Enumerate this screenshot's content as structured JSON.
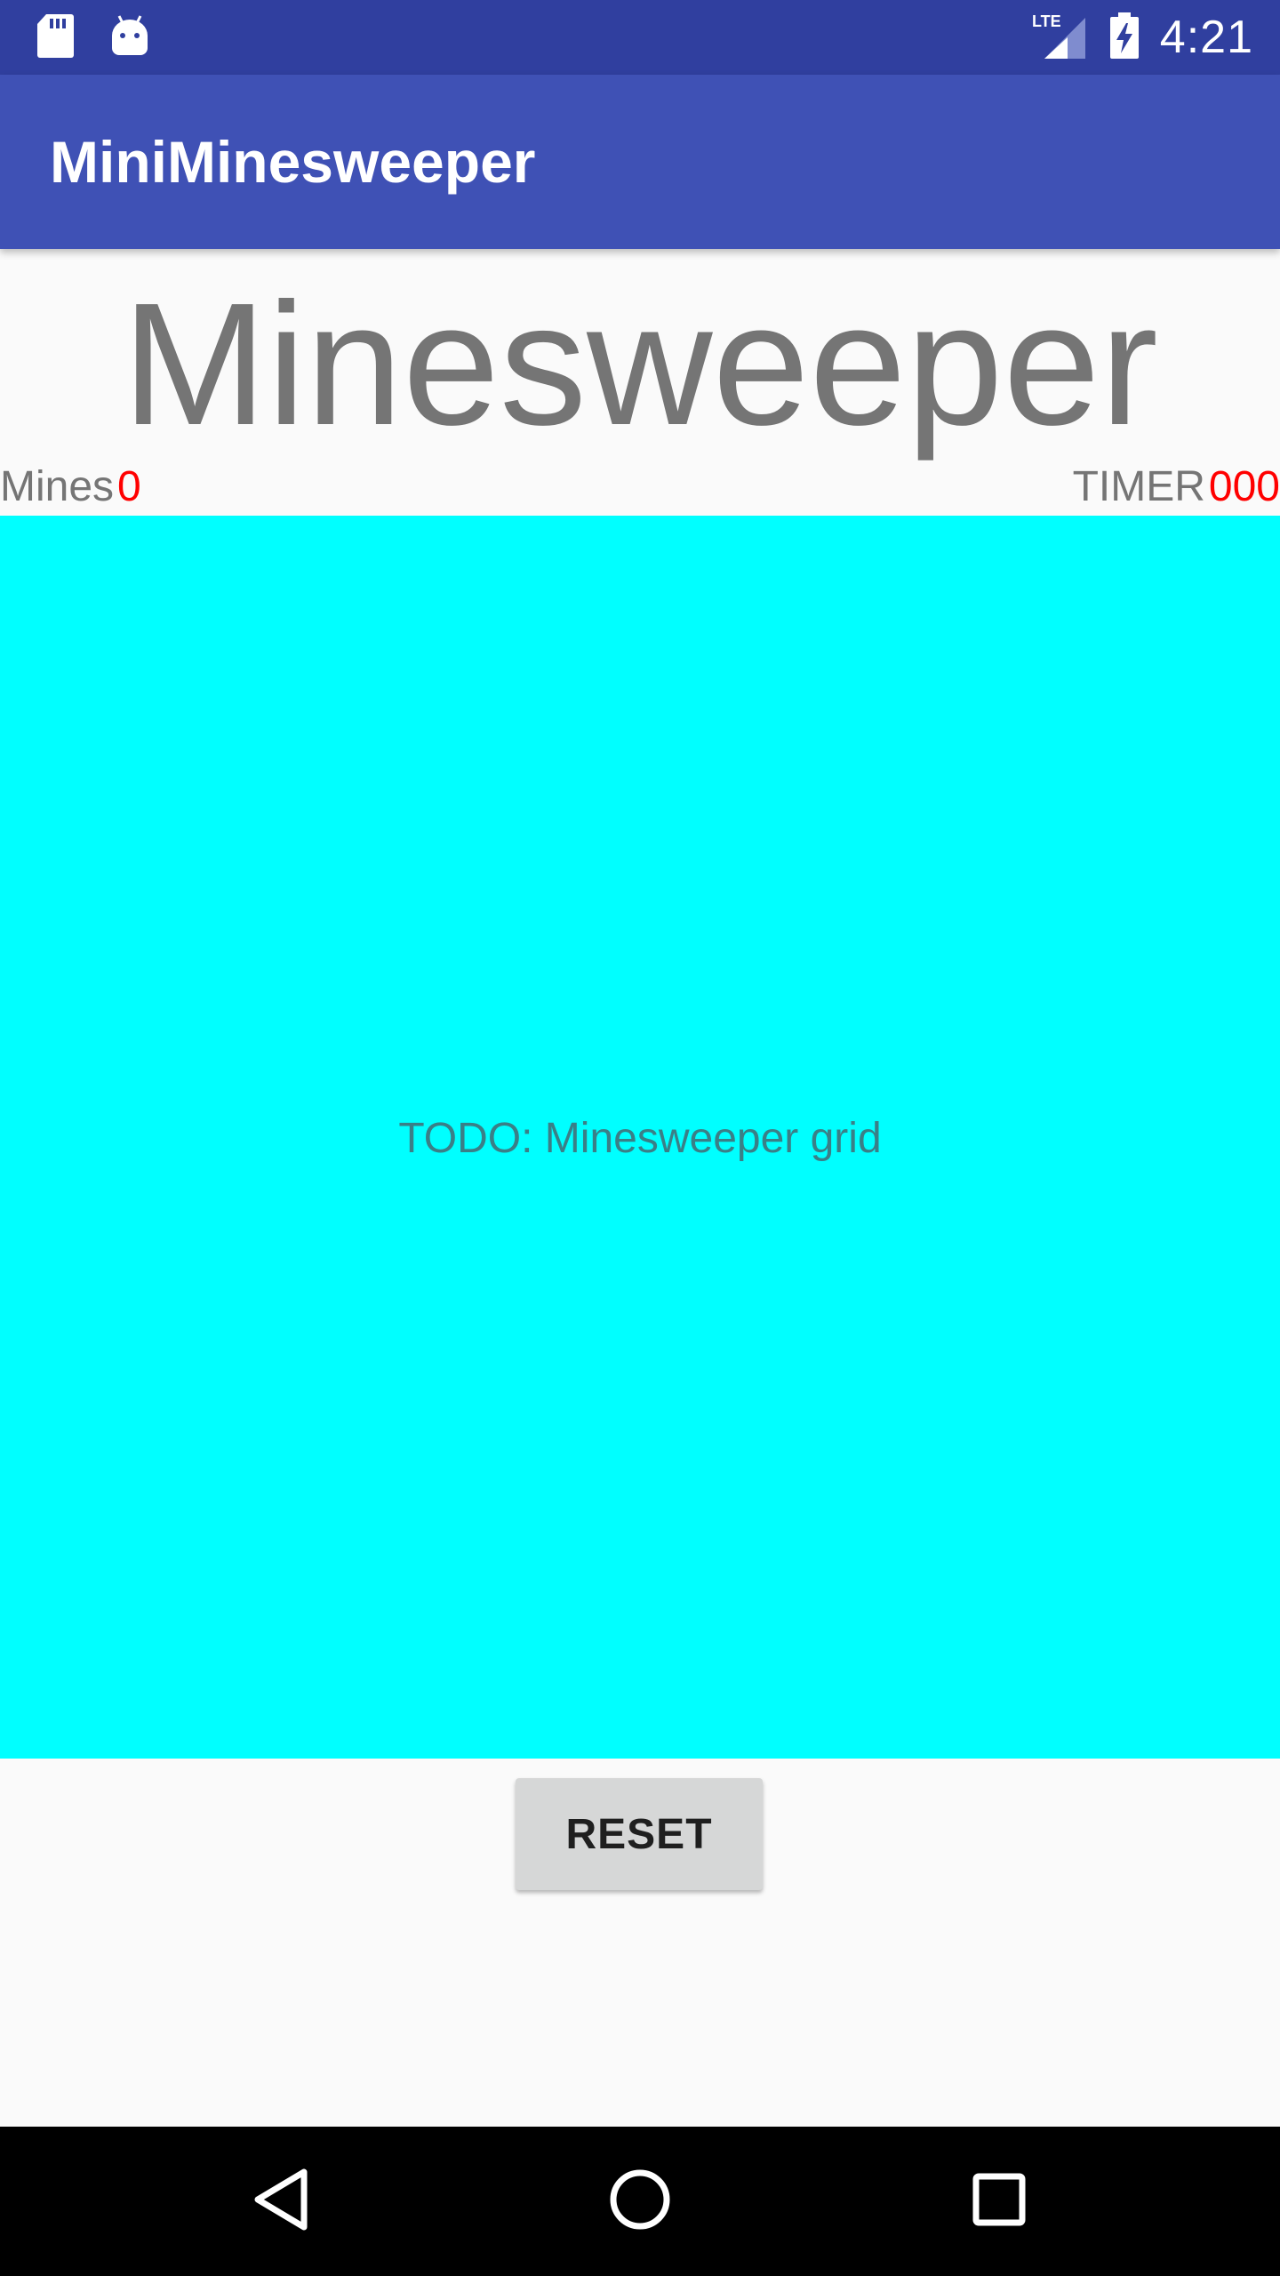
{
  "status_bar": {
    "left_icons": [
      "sd-card-icon",
      "android-icon"
    ],
    "network_label": "LTE",
    "time": "4:21",
    "background_color": "#303f9f"
  },
  "app_bar": {
    "title": "MiniMinesweeper",
    "background_color": "#3f51b5"
  },
  "main": {
    "title": "Minesweeper",
    "mines_label": "Mines",
    "mines_value": "0",
    "timer_label": "TIMER",
    "timer_value": "000",
    "grid_placeholder": "TODO: Minesweeper grid",
    "grid_color": "#00ffff",
    "value_color": "#ff0000",
    "reset_label": "RESET"
  },
  "nav_bar": {
    "buttons": [
      "back-icon",
      "home-icon",
      "recents-icon"
    ]
  }
}
